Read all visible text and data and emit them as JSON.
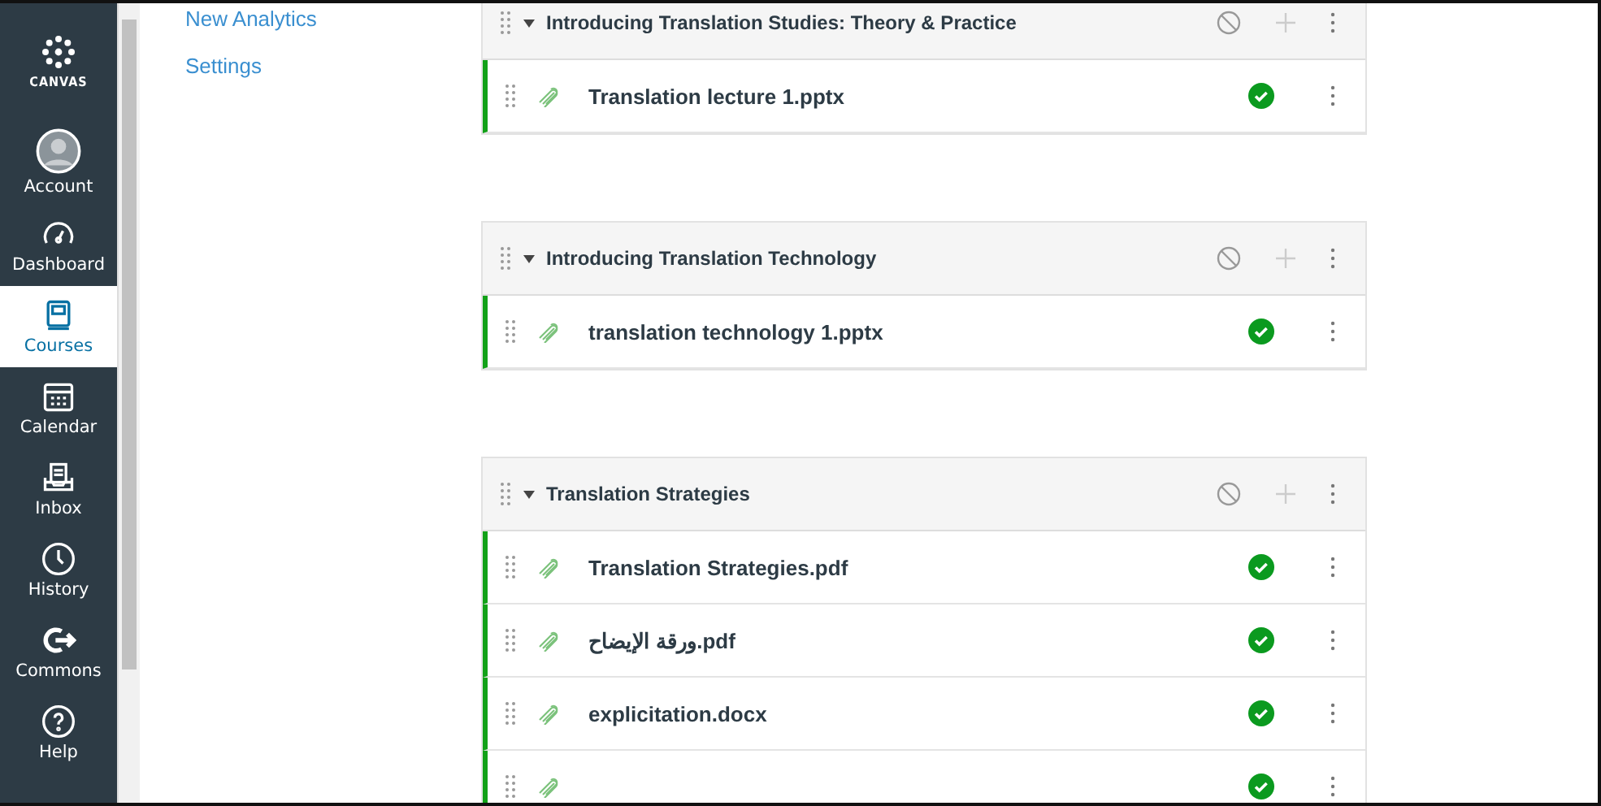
{
  "global_nav": {
    "logo": {
      "text": "CANVAS"
    },
    "items": [
      {
        "label": "Account",
        "kind": "account",
        "selected": false
      },
      {
        "label": "Dashboard",
        "kind": "dashboard",
        "selected": false
      },
      {
        "label": "Courses",
        "kind": "courses",
        "selected": true
      },
      {
        "label": "Calendar",
        "kind": "calendar",
        "selected": false
      },
      {
        "label": "Inbox",
        "kind": "inbox",
        "selected": false
      },
      {
        "label": "History",
        "kind": "history",
        "selected": false
      },
      {
        "label": "Commons",
        "kind": "commons",
        "selected": false
      },
      {
        "label": "Help",
        "kind": "help",
        "selected": false
      }
    ]
  },
  "course_nav": {
    "links": [
      "New Analytics",
      "Settings"
    ]
  },
  "modules": [
    {
      "title": "Introducing Translation Studies: Theory & Practice",
      "items": [
        {
          "name": "Translation lecture 1.pptx",
          "published": true
        }
      ]
    },
    {
      "title": "Introducing Translation Technology",
      "items": [
        {
          "name": "translation technology 1.pptx",
          "published": true
        }
      ]
    },
    {
      "title": "Translation Strategies",
      "items": [
        {
          "name": "Translation Strategies.pdf",
          "published": true
        },
        {
          "name": "ورقة الإيضاح.pdf",
          "published": true
        },
        {
          "name": "explicitation.docx",
          "published": true
        },
        {
          "published": true
        }
      ]
    }
  ]
}
